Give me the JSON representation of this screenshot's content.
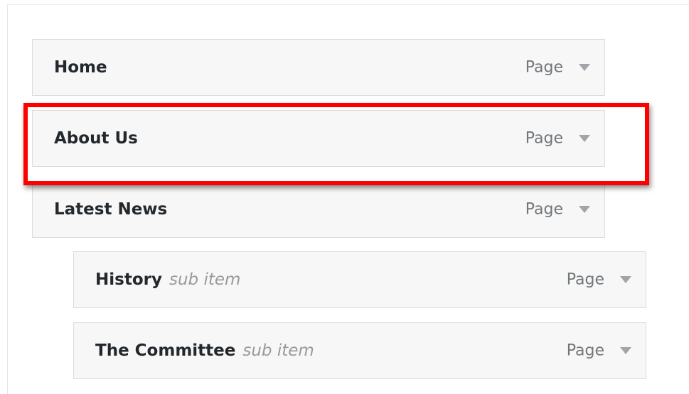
{
  "menu_items": [
    {
      "title": "Home",
      "subtitle": "",
      "type": "Page"
    },
    {
      "title": "About Us",
      "subtitle": "",
      "type": "Page"
    },
    {
      "title": "Latest News",
      "subtitle": "",
      "type": "Page"
    },
    {
      "title": "History",
      "subtitle": "sub item",
      "type": "Page"
    },
    {
      "title": "The Committee",
      "subtitle": "sub item",
      "type": "Page"
    }
  ],
  "colors": {
    "highlight": "#ff0000",
    "item_background": "#f7f7f7",
    "item_border": "#dcdcdc",
    "title_text": "#23282d",
    "subtitle_text": "#9a9a9a",
    "type_text": "#72777c"
  },
  "icons": {
    "toggle": "triangle-down-icon"
  },
  "annotation": {
    "highlighted_item": "About Us",
    "style": "red rectangle"
  }
}
